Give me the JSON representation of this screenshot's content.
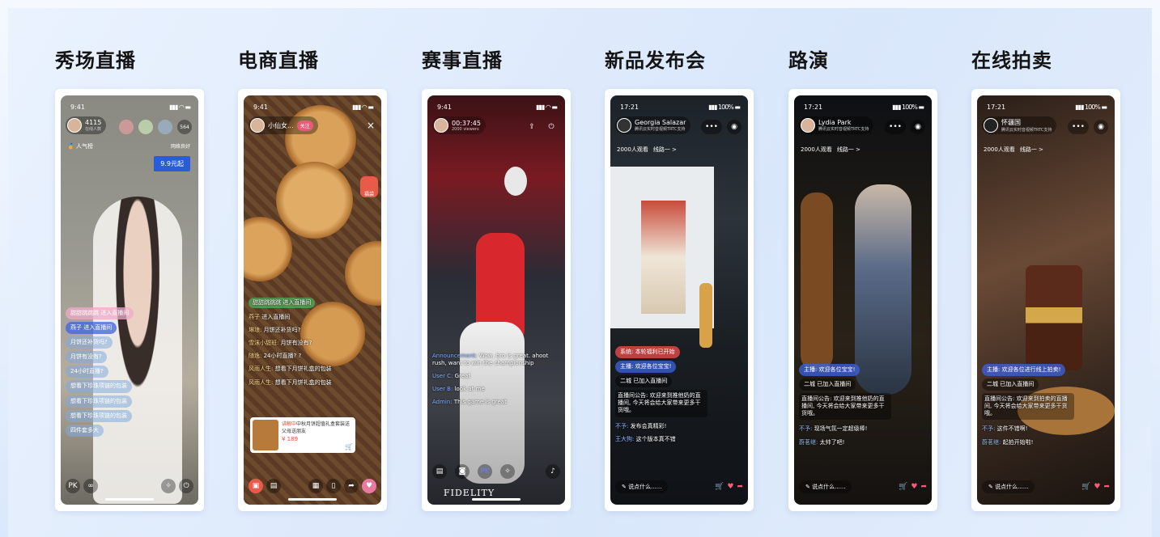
{
  "columns": [
    {
      "title": "秀场直播"
    },
    {
      "title": "电商直播"
    },
    {
      "title": "赛事直播"
    },
    {
      "title": "新品发布会"
    },
    {
      "title": "路演"
    },
    {
      "title": "在线拍卖"
    }
  ],
  "p1": {
    "time": "9:41",
    "viewers": "4115",
    "host_sub": "在线人数",
    "badge": "人气榜",
    "net": "网络良好",
    "count": "564",
    "promo": "9.9元起",
    "chat": [
      "甜甜跳跳跳 进入直播间",
      "燕子 进入直播间",
      "月饼还补货吗?",
      "月饼有没有?",
      "24小时直播?",
      "想看下珍珠项链的包装",
      "想看下珍珠项链的包装",
      "想看下珍珠项链的包装",
      "四件套多大"
    ]
  },
  "p2": {
    "time": "9:41",
    "host": "小仙女...",
    "follow": "关注",
    "close": "×",
    "gift": "福袋",
    "chat": [
      [
        "甜甜跳跳跳",
        "进入直播间"
      ],
      [
        "燕子",
        "进入直播间"
      ],
      [
        "琳琅:",
        "月饼还补货吗?"
      ],
      [
        "雪沫小甜班:",
        "月饼有没有?"
      ],
      [
        "随逸:",
        "24小时直播? ?"
      ],
      [
        "风雨人生:",
        "想看下月饼礼盒的包装"
      ],
      [
        "风雨人生:",
        "想看下月饼礼盒的包装"
      ]
    ],
    "product_tag": "讲解中",
    "product": "中秋月饼超值礼盒套装送父母送朋友",
    "price": "¥ 189"
  },
  "p3": {
    "time": "9:41",
    "timer": "00:37:45",
    "viewers": "2000 viewers",
    "chat": [
      [
        "Announcement:",
        "Wow, bro is great. ahoot rush, want to win the championship"
      ],
      [
        "User C:",
        "Great"
      ],
      [
        "User B:",
        "look at me"
      ],
      [
        "Admin:",
        "This game is great"
      ]
    ],
    "sponsor": "FIDELITY"
  },
  "p4": {
    "time": "17:21",
    "host": "Georgia Salazar",
    "host_sub": "腾讯云实时音视频TRTC支持",
    "viewers": "2000人观看",
    "route": "线路一 >",
    "sys": "系统: 本轮福利已开始",
    "host_msg": "主播: 欢迎各位宝宝!",
    "join": "二城 已加入直播间",
    "notice": "直播间公告: 欢迎来到推他奶的直播间, 今天将会给大家带来更多干货哦。",
    "msg1": [
      "不予:",
      "发布会真精彩!"
    ],
    "msg2": [
      "王大狗:",
      "这个版本真不错"
    ],
    "say": "说点什么......"
  },
  "p5": {
    "time": "17:21",
    "host": "Lydia Park",
    "host_sub": "腾讯云实时音视频TRTC支持",
    "viewers": "2000人观看",
    "route": "线路一 >",
    "host_msg": "主播: 欢迎各位宝宝!",
    "join": "二城 已加入直播间",
    "notice": "直播间公告: 欢迎来到推他奶的直播间, 今天将会给大家带来更多干货哦。",
    "msg1": [
      "不予:",
      "现场气氛一定超级棒!"
    ],
    "msg2": [
      "蔚茗继:",
      "太帅了吧!"
    ],
    "say": "说点什么......"
  },
  "p6": {
    "time": "17:21",
    "host": "怀疆国",
    "host_sub": "腾讯云实时音视频TRTC支持",
    "viewers": "2000人观看",
    "route": "线路一 >",
    "host_msg": "主播: 欢迎各位进行线上拍卖!",
    "join": "二城 已加入直播间",
    "notice": "直播间公告: 欢迎来到拍卖的直播间, 今天将会给大家带来更多干货哦。",
    "msg1": [
      "不予:",
      "这件不错啊!"
    ],
    "msg2": [
      "蔚茗继:",
      "起拍开始啦!"
    ],
    "say": "说点什么......"
  }
}
